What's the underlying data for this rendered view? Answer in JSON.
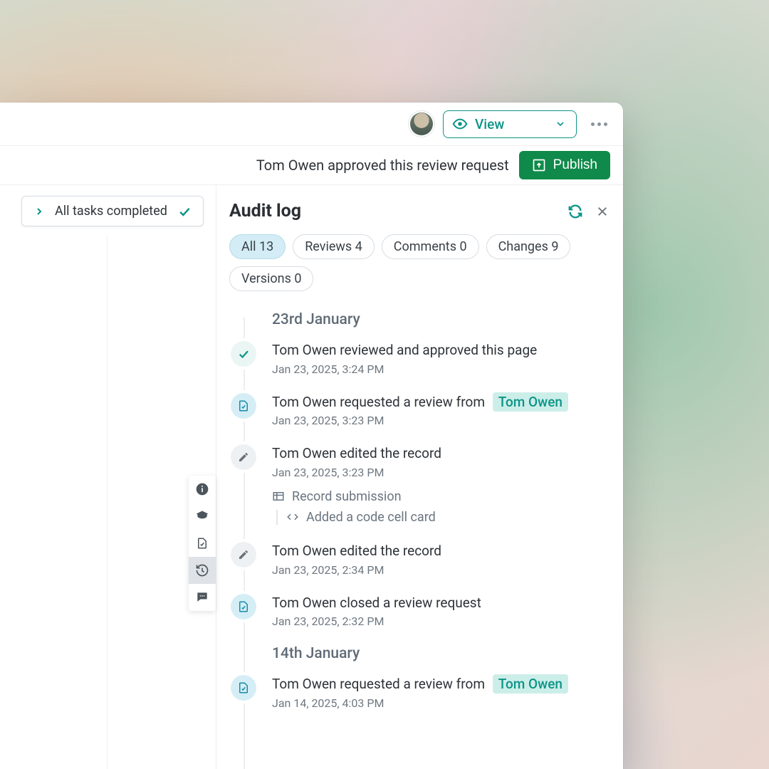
{
  "header": {
    "view_label": "View",
    "status_text": "Tom Owen approved this review request",
    "publish_label": "Publish"
  },
  "tasks": {
    "label": "All tasks completed"
  },
  "panel": {
    "title": "Audit log"
  },
  "filters": [
    {
      "label": "All",
      "count": "13",
      "active": true
    },
    {
      "label": "Reviews",
      "count": "4",
      "active": false
    },
    {
      "label": "Comments",
      "count": "0",
      "active": false
    },
    {
      "label": "Changes",
      "count": "9",
      "active": false
    },
    {
      "label": "Versions",
      "count": "0",
      "active": false
    }
  ],
  "groups": [
    {
      "date": "23rd January",
      "entries": [
        {
          "icon": "check",
          "title_pre": "Tom Owen reviewed and approved this page",
          "mention": "",
          "time": "Jan 23, 2025, 3:24 PM"
        },
        {
          "icon": "doc",
          "title_pre": "Tom Owen requested a review from",
          "mention": "Tom Owen",
          "time": "Jan 23, 2025, 3:23 PM"
        },
        {
          "icon": "edit",
          "title_pre": "Tom Owen edited the record",
          "mention": "",
          "time": "Jan 23, 2025, 3:23 PM",
          "sub_section": "Record submission",
          "sub_detail": "Added a code cell card"
        },
        {
          "icon": "edit",
          "title_pre": "Tom Owen edited the record",
          "mention": "",
          "time": "Jan 23, 2025, 2:34 PM"
        },
        {
          "icon": "doc",
          "title_pre": "Tom Owen closed a review request",
          "mention": "",
          "time": "Jan 23, 2025, 2:32 PM"
        }
      ]
    },
    {
      "date": "14th January",
      "entries": [
        {
          "icon": "doc",
          "title_pre": "Tom Owen requested a review from",
          "mention": "Tom Owen",
          "time": "Jan 14, 2025, 4:03 PM"
        }
      ]
    }
  ]
}
